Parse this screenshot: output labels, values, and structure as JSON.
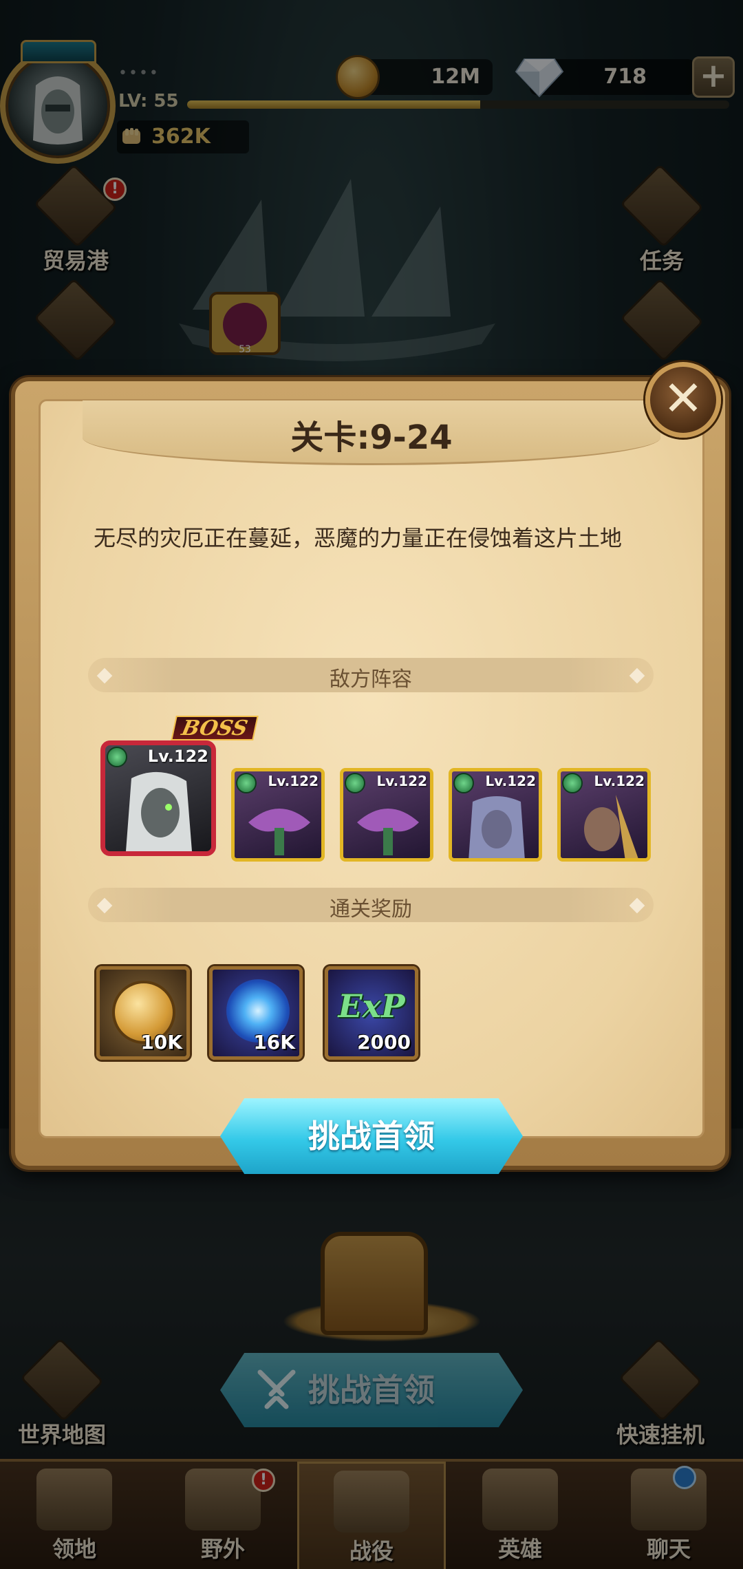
{
  "top_bar": {
    "vip_dots": "••••",
    "level_label": "LV: 55",
    "exp_fraction": 0.54,
    "power": "362K",
    "gold": "12M",
    "gems": "718",
    "plus_label": "+"
  },
  "side_buttons": {
    "trade_port": "贸易港",
    "tasks": "任务",
    "world_map": "世界地图",
    "quick_idle": "快速挂机",
    "trade_badge": "!"
  },
  "stage_marker": {
    "number": "53"
  },
  "modal": {
    "title": "关卡:9-24",
    "close_label": "✕",
    "description": "无尽的灾厄正在蔓延，恶魔的力量正在侵蚀着这片土地",
    "enemy_section": "敌方阵容",
    "reward_section": "通关奖励",
    "boss_tag": "BOSS",
    "enemies": [
      {
        "level": "Lv.122",
        "boss": true
      },
      {
        "level": "Lv.122",
        "boss": false
      },
      {
        "level": "Lv.122",
        "boss": false
      },
      {
        "level": "Lv.122",
        "boss": false
      },
      {
        "level": "Lv.122",
        "boss": false
      }
    ],
    "rewards": [
      {
        "type": "gold",
        "qty": "10K"
      },
      {
        "type": "hero-essence",
        "qty": "16K"
      },
      {
        "type": "exp",
        "qty": "2000",
        "icon_text": "ExP"
      }
    ],
    "challenge_button": "挑战首领"
  },
  "main": {
    "challenge_button": "挑战首领"
  },
  "nav": {
    "items": [
      {
        "label": "领地",
        "badge": ""
      },
      {
        "label": "野外",
        "badge": "!"
      },
      {
        "label": "战役",
        "badge": ""
      },
      {
        "label": "英雄",
        "badge": ""
      },
      {
        "label": "聊天",
        "badge": ""
      }
    ]
  },
  "colors": {
    "accent_cyan": "#34c9e8",
    "gold": "#e9c66a",
    "boss_red": "#c8283a",
    "parchment": "#f6e2b9"
  }
}
